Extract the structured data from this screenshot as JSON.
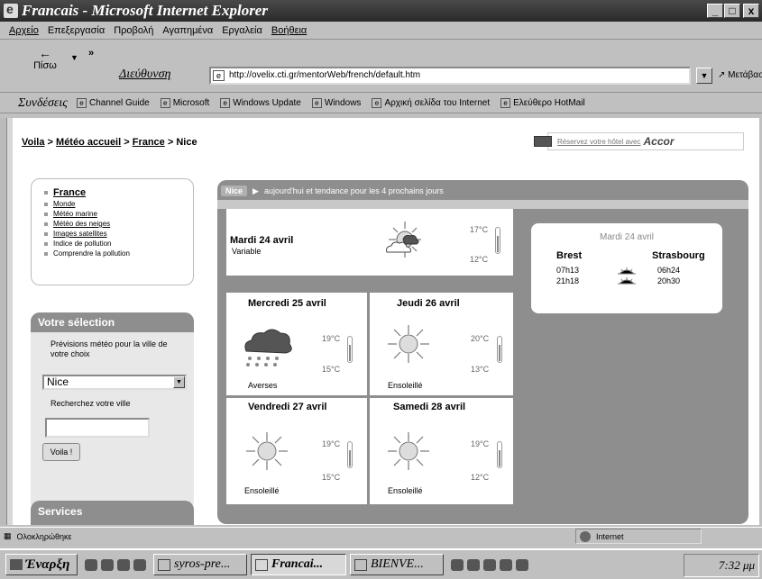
{
  "window": {
    "title": "Francais - Microsoft Internet Explorer",
    "min": "_",
    "max": "□",
    "close": "x"
  },
  "menu": [
    "Αρχείο",
    "Επεξεργασία",
    "Προβολή",
    "Αγαπημένα",
    "Εργαλεία",
    "Βοήθεια"
  ],
  "toolbar": {
    "back_label": "Πίσω",
    "address_label": "Διεύθυνση",
    "url": "http://ovelix.cti.gr/mentorWeb/french/default.htm",
    "goto_label": "Μετάβαση"
  },
  "links": {
    "label": "Συνδέσεις",
    "items": [
      "Channel Guide",
      "Microsoft",
      "Windows Update",
      "Windows",
      "Αρχική σελίδα του Internet",
      "Ελεύθερο HotMail"
    ]
  },
  "breadcrumb": {
    "c1": "Voila",
    "sep": " > ",
    "c2": "Météo accueil",
    "c3": "France",
    "c4": "Nice"
  },
  "hotel": {
    "text": "Réservez votre hôtel avec",
    "brand": "Accor"
  },
  "nav": {
    "main": "France",
    "items": [
      "Monde",
      "Météo marine",
      "Météo des neiges",
      "Images satellites",
      "Indice de pollution",
      "Comprendre la pollution"
    ]
  },
  "selection": {
    "title": "Votre sélection",
    "text1": "Prévisions météo pour la ville de votre choix",
    "city": "Nice",
    "text2": "Recherchez votre ville",
    "button": "Voila !"
  },
  "services": {
    "title": "Services"
  },
  "forecast": {
    "city": "Nice",
    "header": "aujourd'hui et tendance pour les 4 prochains jours",
    "today": {
      "day": "Mardi 24 avril",
      "desc": "Variable",
      "tmax": "17°C",
      "tmin": "12°C"
    },
    "days": [
      {
        "day": "Mercredi 25 avril",
        "desc": "Averses",
        "tmax": "19°C",
        "tmin": "15°C"
      },
      {
        "day": "Jeudi 26 avril",
        "desc": "Ensoleillé",
        "tmax": "20°C",
        "tmin": "13°C"
      },
      {
        "day": "Vendredi 27 avril",
        "desc": "Ensoleillé",
        "tmax": "19°C",
        "tmin": "15°C"
      },
      {
        "day": "Samedi 28 avril",
        "desc": "Ensoleillé",
        "tmax": "19°C",
        "tmin": "12°C"
      }
    ],
    "ephemeris": {
      "date": "Mardi 24 avril",
      "city1": "Brest",
      "city2": "Strasbourg",
      "rise1": "07h13",
      "set1": "21h18",
      "rise2": "06h24",
      "set2": "20h30"
    }
  },
  "status": {
    "text": "Ολοκληρώθηκε",
    "zone": "Internet"
  },
  "taskbar": {
    "start": "Έναρξη",
    "tasks": [
      "syros-pre...",
      "Francai...",
      "BIENVE..."
    ],
    "clock": "7:32 μμ"
  }
}
